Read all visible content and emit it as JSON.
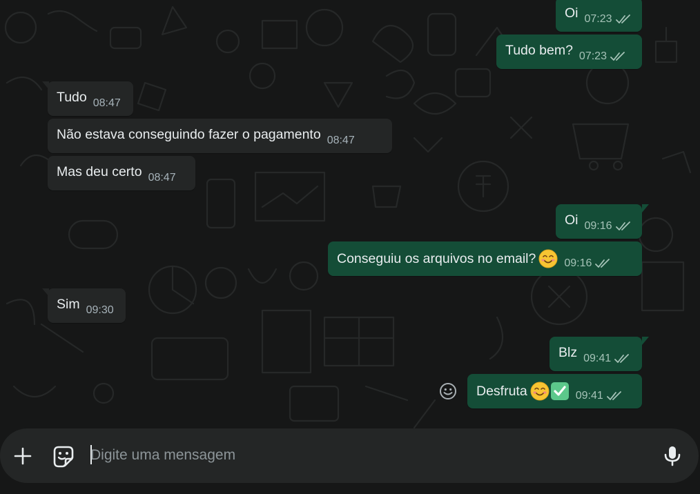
{
  "theme": {
    "background": "#161717",
    "incoming_bubble": "#242626",
    "outgoing_bubble": "#144d37",
    "read_ticks": "#a6c3b8",
    "composer": "#242626"
  },
  "messages": [
    {
      "direction": "out",
      "text": "Oi",
      "time": "07:23",
      "status": "delivered-double-check"
    },
    {
      "direction": "out",
      "text": "Tudo bem?",
      "time": "07:23",
      "status": "delivered-double-check"
    },
    {
      "direction": "in",
      "text": "Tudo",
      "time": "08:47"
    },
    {
      "direction": "in",
      "text": "Não estava conseguindo fazer o pagamento",
      "time": "08:47"
    },
    {
      "direction": "in",
      "text": "Mas deu certo",
      "time": "08:47"
    },
    {
      "direction": "out",
      "text": "Oi",
      "time": "09:16",
      "status": "delivered-double-check"
    },
    {
      "direction": "out",
      "text": "Conseguiu os arquivos no email?",
      "emoji": [
        "smiling-face-emoji"
      ],
      "time": "09:16",
      "status": "delivered-double-check"
    },
    {
      "direction": "in",
      "text": "Sim",
      "time": "09:30"
    },
    {
      "direction": "out",
      "text": "Blz",
      "time": "09:41",
      "status": "delivered-double-check"
    },
    {
      "direction": "out",
      "text": "Desfruta",
      "emoji": [
        "smiling-face-emoji",
        "check-mark-button-emoji"
      ],
      "time": "09:41",
      "status": "delivered-double-check"
    }
  ],
  "composer": {
    "placeholder": "Digite uma mensagem",
    "value": "",
    "attach_icon": "plus-icon",
    "sticker_icon": "sticker-icon",
    "voice_icon": "microphone-icon"
  },
  "react_icon": "emoji-reaction-icon"
}
